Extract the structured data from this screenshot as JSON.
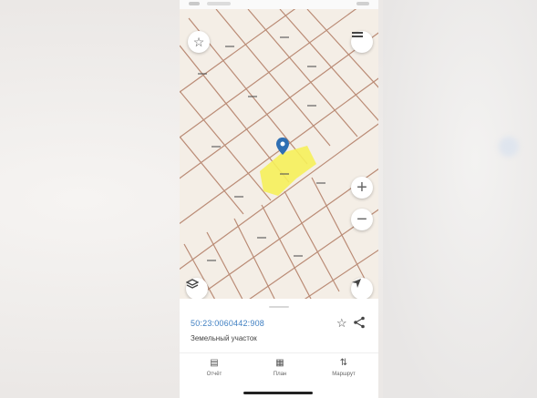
{
  "map": {
    "parcel_labels": [
      "·····",
      "·····",
      "·····",
      "·····",
      "·····",
      "·····"
    ],
    "controls": {
      "favorite_icon": "star-outline-icon",
      "layers_top_icon": "layers-bar-icon",
      "zoom_in": "+",
      "zoom_out": "−",
      "layers_icon": "layers-icon",
      "locate_icon": "navigation-arrow-icon"
    },
    "highlight_color": "#f6f05a",
    "marker_color": "#2f6fb3"
  },
  "sheet": {
    "parcel_id": "50:23:0060442:908",
    "parcel_type": "Земельный участок"
  },
  "tabs": [
    {
      "label": "Отчёт",
      "icon": "document-icon"
    },
    {
      "label": "План",
      "icon": "plan-icon"
    },
    {
      "label": "Маршрут",
      "icon": "route-icon"
    }
  ]
}
